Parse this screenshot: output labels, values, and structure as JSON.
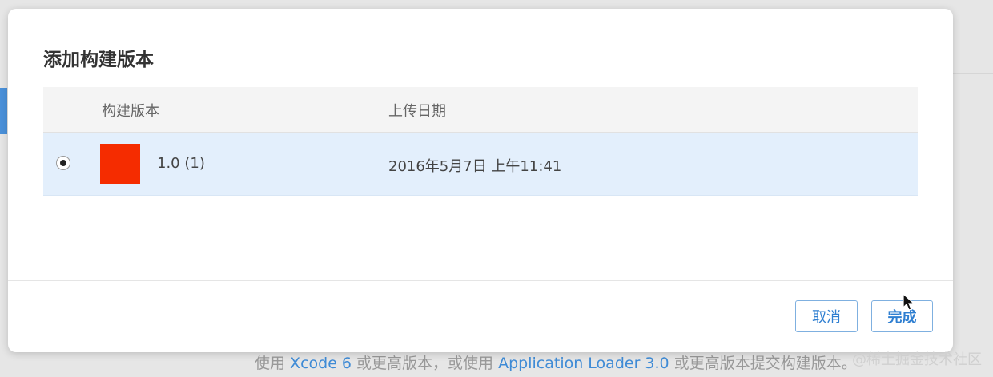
{
  "dialog": {
    "title": "添加构建版本",
    "columns": {
      "build": "构建版本",
      "upload_date": "上传日期"
    },
    "rows": [
      {
        "selected": true,
        "version": "1.0 (1)",
        "upload_date": "2016年5月7日 上午11:41",
        "icon_color": "#f52c00"
      }
    ],
    "buttons": {
      "cancel": "取消",
      "done": "完成"
    }
  },
  "background": {
    "text_before_link1": "使用 ",
    "link1": "Xcode 6",
    "text_between": " 或更高版本，或使用 ",
    "link2": "Application Loader 3.0",
    "text_after": " 或更高版本提交构建版本。"
  },
  "watermark": "@稀土掘金技术社区",
  "colors": {
    "accent": "#2f7fd1",
    "selected_row": "#e3effc",
    "app_icon": "#f52c00"
  }
}
